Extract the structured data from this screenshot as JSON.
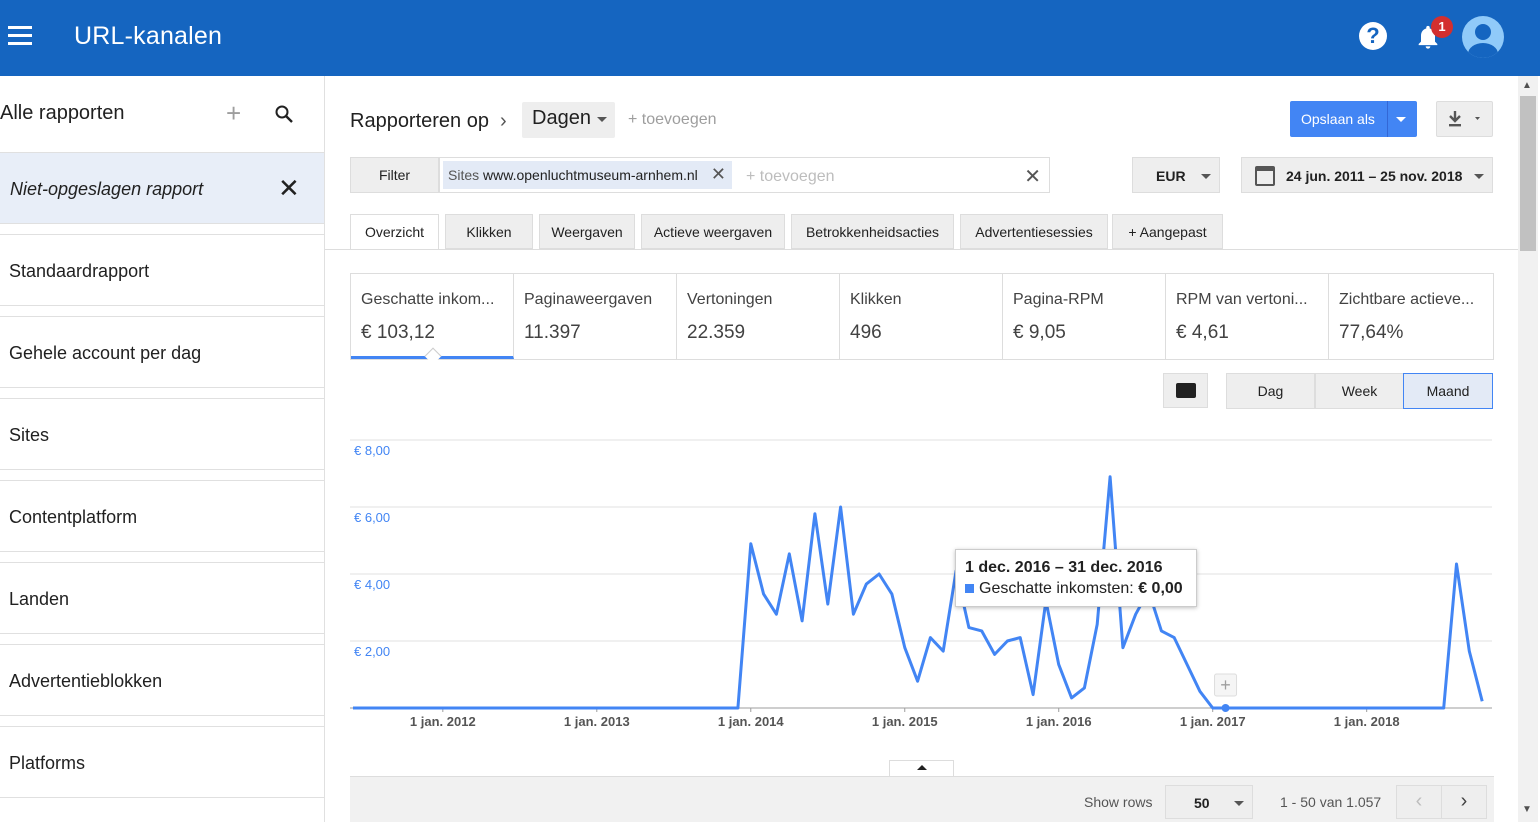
{
  "app": {
    "title": "URL-kanalen",
    "notification_count": "1"
  },
  "sidebar": {
    "header": "Alle rapporten",
    "unsaved": "Niet-opgeslagen rapport",
    "items": [
      "Standaardrapport",
      "Gehele account per dag",
      "Sites",
      "Contentplatform",
      "Landen",
      "Advertentieblokken",
      "Platforms"
    ]
  },
  "report": {
    "breadcrumb": "Rapporteren op",
    "dimension": "Dagen",
    "add_dimension": "+ toevoegen",
    "save_label": "Opslaan als",
    "filter_label": "Filter",
    "filter_chip_prefix": "Sites",
    "filter_chip_value": "www.openluchtmuseum-arnhem.nl",
    "filter_placeholder": "+ toevoegen",
    "currency": "EUR",
    "date_range": "24 jun. 2011 – 25 nov. 2018"
  },
  "tabs": [
    "Overzicht",
    "Klikken",
    "Weergaven",
    "Actieve weergaven",
    "Betrokkenheidsacties",
    "Advertentiesessies",
    "Aangepast"
  ],
  "metrics": [
    {
      "label": "Geschatte inkom...",
      "value": "€ 103,12"
    },
    {
      "label": "Paginaweergaven",
      "value": "11.397"
    },
    {
      "label": "Vertoningen",
      "value": "22.359"
    },
    {
      "label": "Klikken",
      "value": "496"
    },
    {
      "label": "Pagina-RPM",
      "value": "€ 9,05"
    },
    {
      "label": "RPM van vertoni...",
      "value": "€ 4,61"
    },
    {
      "label": "Zichtbare actieve...",
      "value": "77,64%"
    }
  ],
  "period": {
    "options": [
      "Dag",
      "Week",
      "Maand"
    ],
    "selected": "Maand"
  },
  "tooltip": {
    "date": "1 dec. 2016 – 31 dec. 2016",
    "series": "Geschatte inkomsten:",
    "value": "€ 0,00"
  },
  "footer": {
    "show_rows_label": "Show rows",
    "rows": "50",
    "range": "1 - 50 van 1.057"
  },
  "colors": {
    "header": "#1565c0",
    "line": "#4285f4",
    "accent": "#4285f4"
  },
  "chart_data": {
    "type": "line",
    "ylim": [
      0,
      8
    ],
    "yticks": [
      "€ 8,00",
      "€ 6,00",
      "€ 4,00",
      "€ 2,00"
    ],
    "ytick_values": [
      8,
      6,
      4,
      2
    ],
    "xticks": [
      "1 jan. 2012",
      "1 jan. 2013",
      "1 jan. 2014",
      "1 jan. 2015",
      "1 jan. 2016",
      "1 jan. 2017",
      "1 jan. 2018"
    ],
    "xtick_months": [
      7,
      19,
      31,
      43,
      55,
      67,
      79
    ],
    "x_start_month": 0,
    "x_end_month": 89,
    "series": [
      {
        "name": "Geschatte inkomsten",
        "months": [
          0,
          30,
          31,
          32,
          33,
          34,
          35,
          36,
          37,
          38,
          39,
          40,
          41,
          42,
          43,
          44,
          45,
          46,
          47,
          48,
          49,
          50,
          51,
          52,
          53,
          54,
          55,
          56,
          57,
          58,
          59,
          60,
          61,
          62,
          63,
          64,
          65,
          66,
          67,
          68,
          85,
          86,
          87,
          88
        ],
        "values": [
          0,
          0,
          4.9,
          3.4,
          2.8,
          4.6,
          2.6,
          5.8,
          3.1,
          6.0,
          2.8,
          3.7,
          4.0,
          3.4,
          1.8,
          0.8,
          2.1,
          1.7,
          4.1,
          2.4,
          2.3,
          1.6,
          2.0,
          2.1,
          0.4,
          3.2,
          1.3,
          0.3,
          0.6,
          2.5,
          6.9,
          1.8,
          2.8,
          3.5,
          2.3,
          2.1,
          1.3,
          0.5,
          0,
          0,
          0,
          4.3,
          1.7,
          0.2
        ]
      }
    ]
  }
}
